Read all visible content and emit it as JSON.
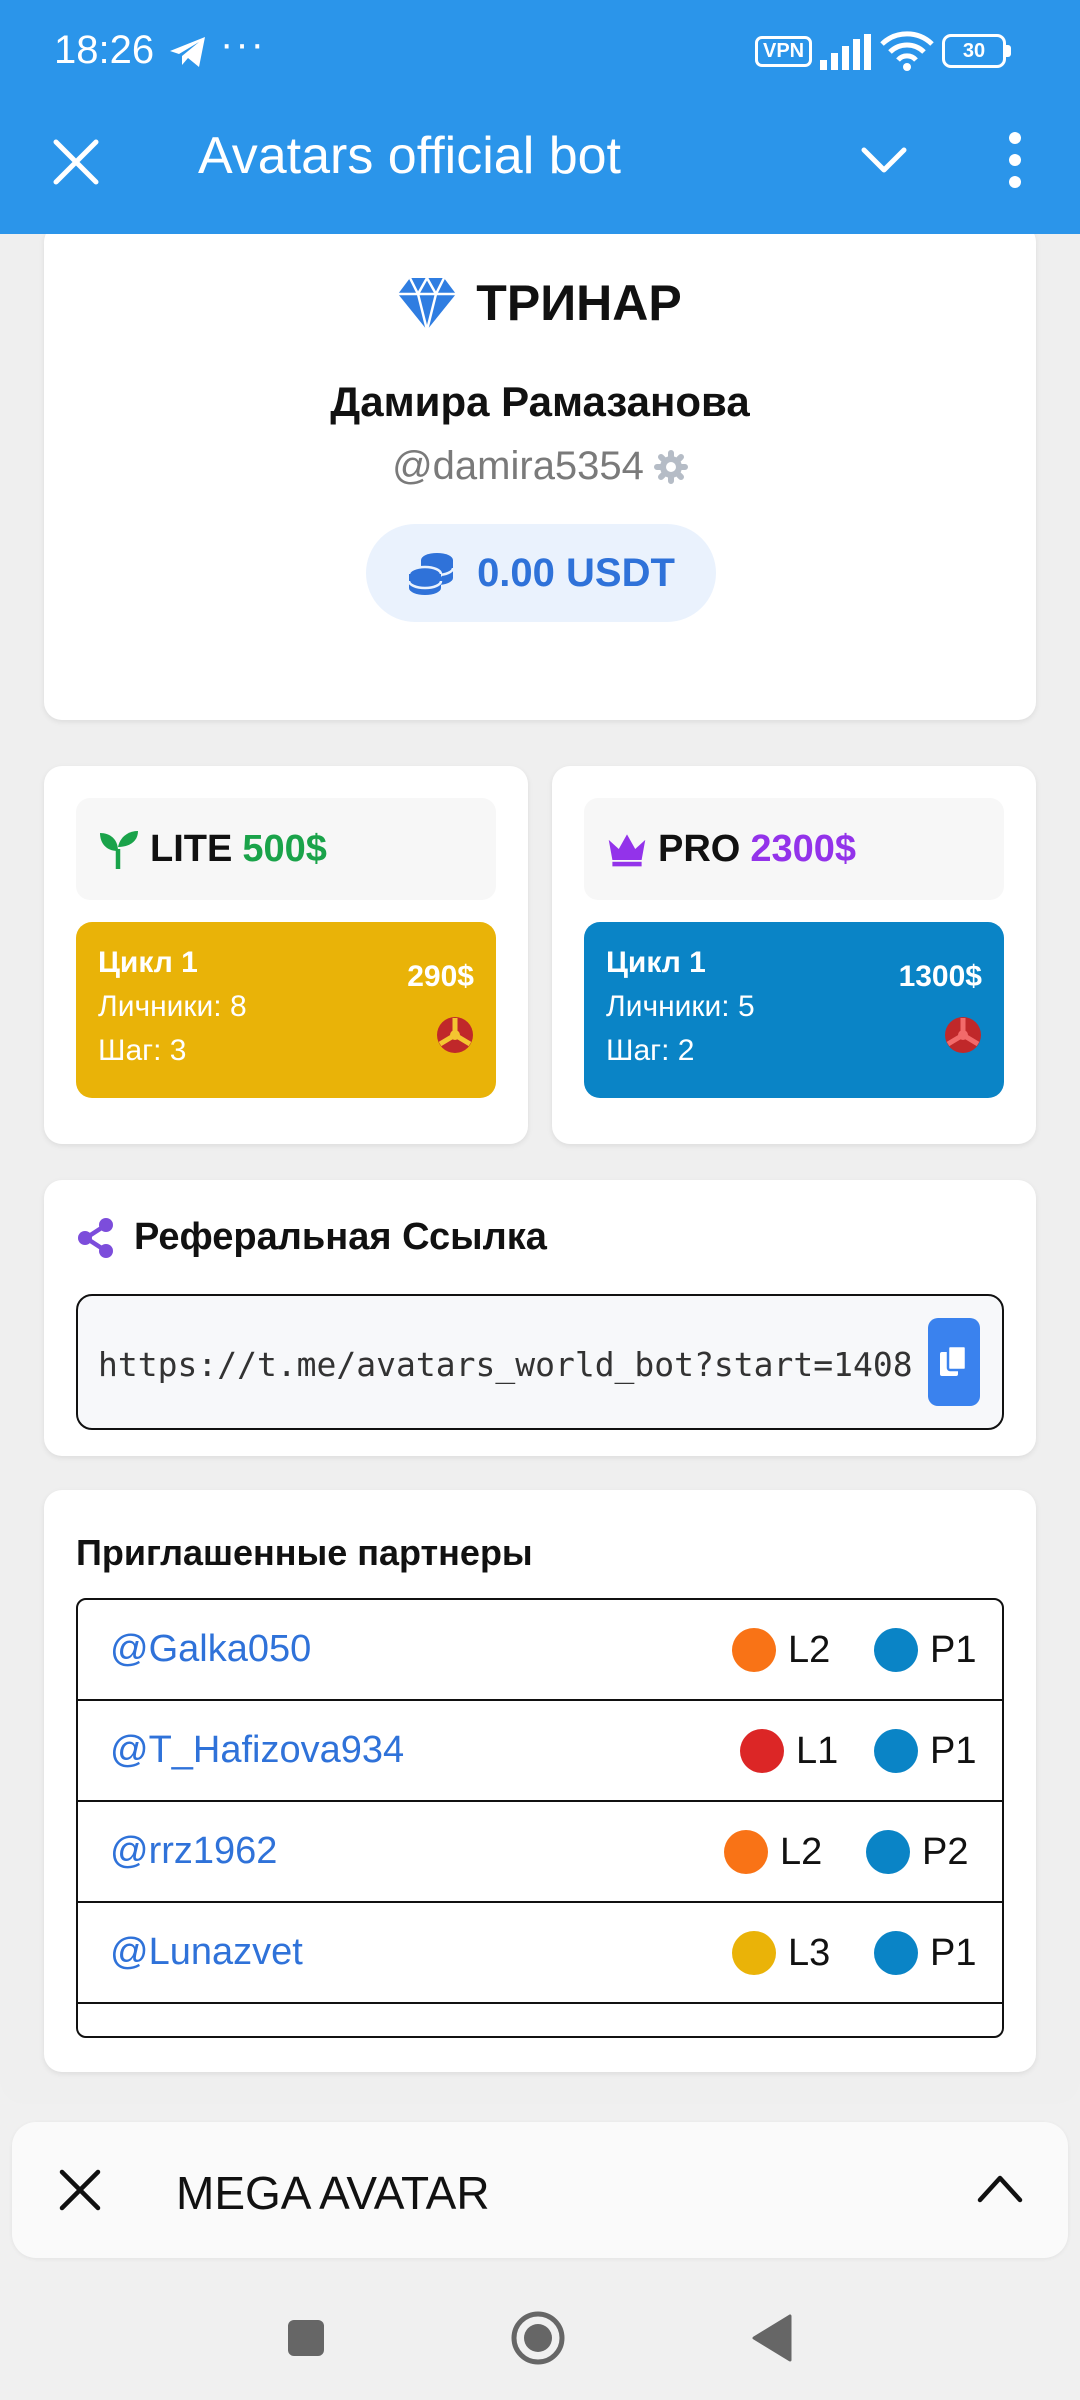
{
  "status_bar": {
    "time": "18:26",
    "more": "···",
    "vpn": "VPN",
    "battery": "30"
  },
  "app_bar": {
    "title": "Avatars official bot",
    "close_icon": "close-icon",
    "collapse_icon": "chevron-down-icon",
    "menu_icon": "more-vertical-icon"
  },
  "profile": {
    "org_name": "ТРИНАР",
    "full_name": "Дамира Рамазанова",
    "username": "@damira5354",
    "balance": "0.00 USDT"
  },
  "plans": [
    {
      "name": "LITE",
      "price": "500$",
      "price_color": "#1aa34a",
      "cycle": "Цикл 1",
      "personal": "Личники: 8",
      "step": "Шаг: 3",
      "amount": "290$",
      "card_color": "#e9b308"
    },
    {
      "name": "PRO",
      "price": "2300$",
      "price_color": "#9333ea",
      "cycle": "Цикл 1",
      "personal": "Личники: 5",
      "step": "Шаг: 2",
      "amount": "1300$",
      "card_color": "#0a84c6"
    }
  ],
  "referral": {
    "title": "Реферальная Ссылка",
    "link": "https://t.me/avatars_world_bot?start=1408"
  },
  "partners": {
    "title": "Приглашенные партнеры",
    "rows": [
      {
        "user": "@Galka050",
        "level": "L2",
        "level_color": "#f97316",
        "plan": "P1",
        "plan_color": "#0a84c6"
      },
      {
        "user": "@T_Hafizova934",
        "level": "L1",
        "level_color": "#dc2626",
        "plan": "P1",
        "plan_color": "#0a84c6"
      },
      {
        "user": "@rrz1962",
        "level": "L2",
        "level_color": "#f97316",
        "plan": "P2",
        "plan_color": "#0a84c6"
      },
      {
        "user": "@Lunazvet",
        "level": "L3",
        "level_color": "#eab308",
        "plan": "P1",
        "plan_color": "#0a84c6"
      }
    ]
  },
  "mini_app": {
    "title": "MEGA AVATAR"
  },
  "colors": {
    "header": "#2b95ea",
    "accent_blue": "#2f72d9"
  }
}
